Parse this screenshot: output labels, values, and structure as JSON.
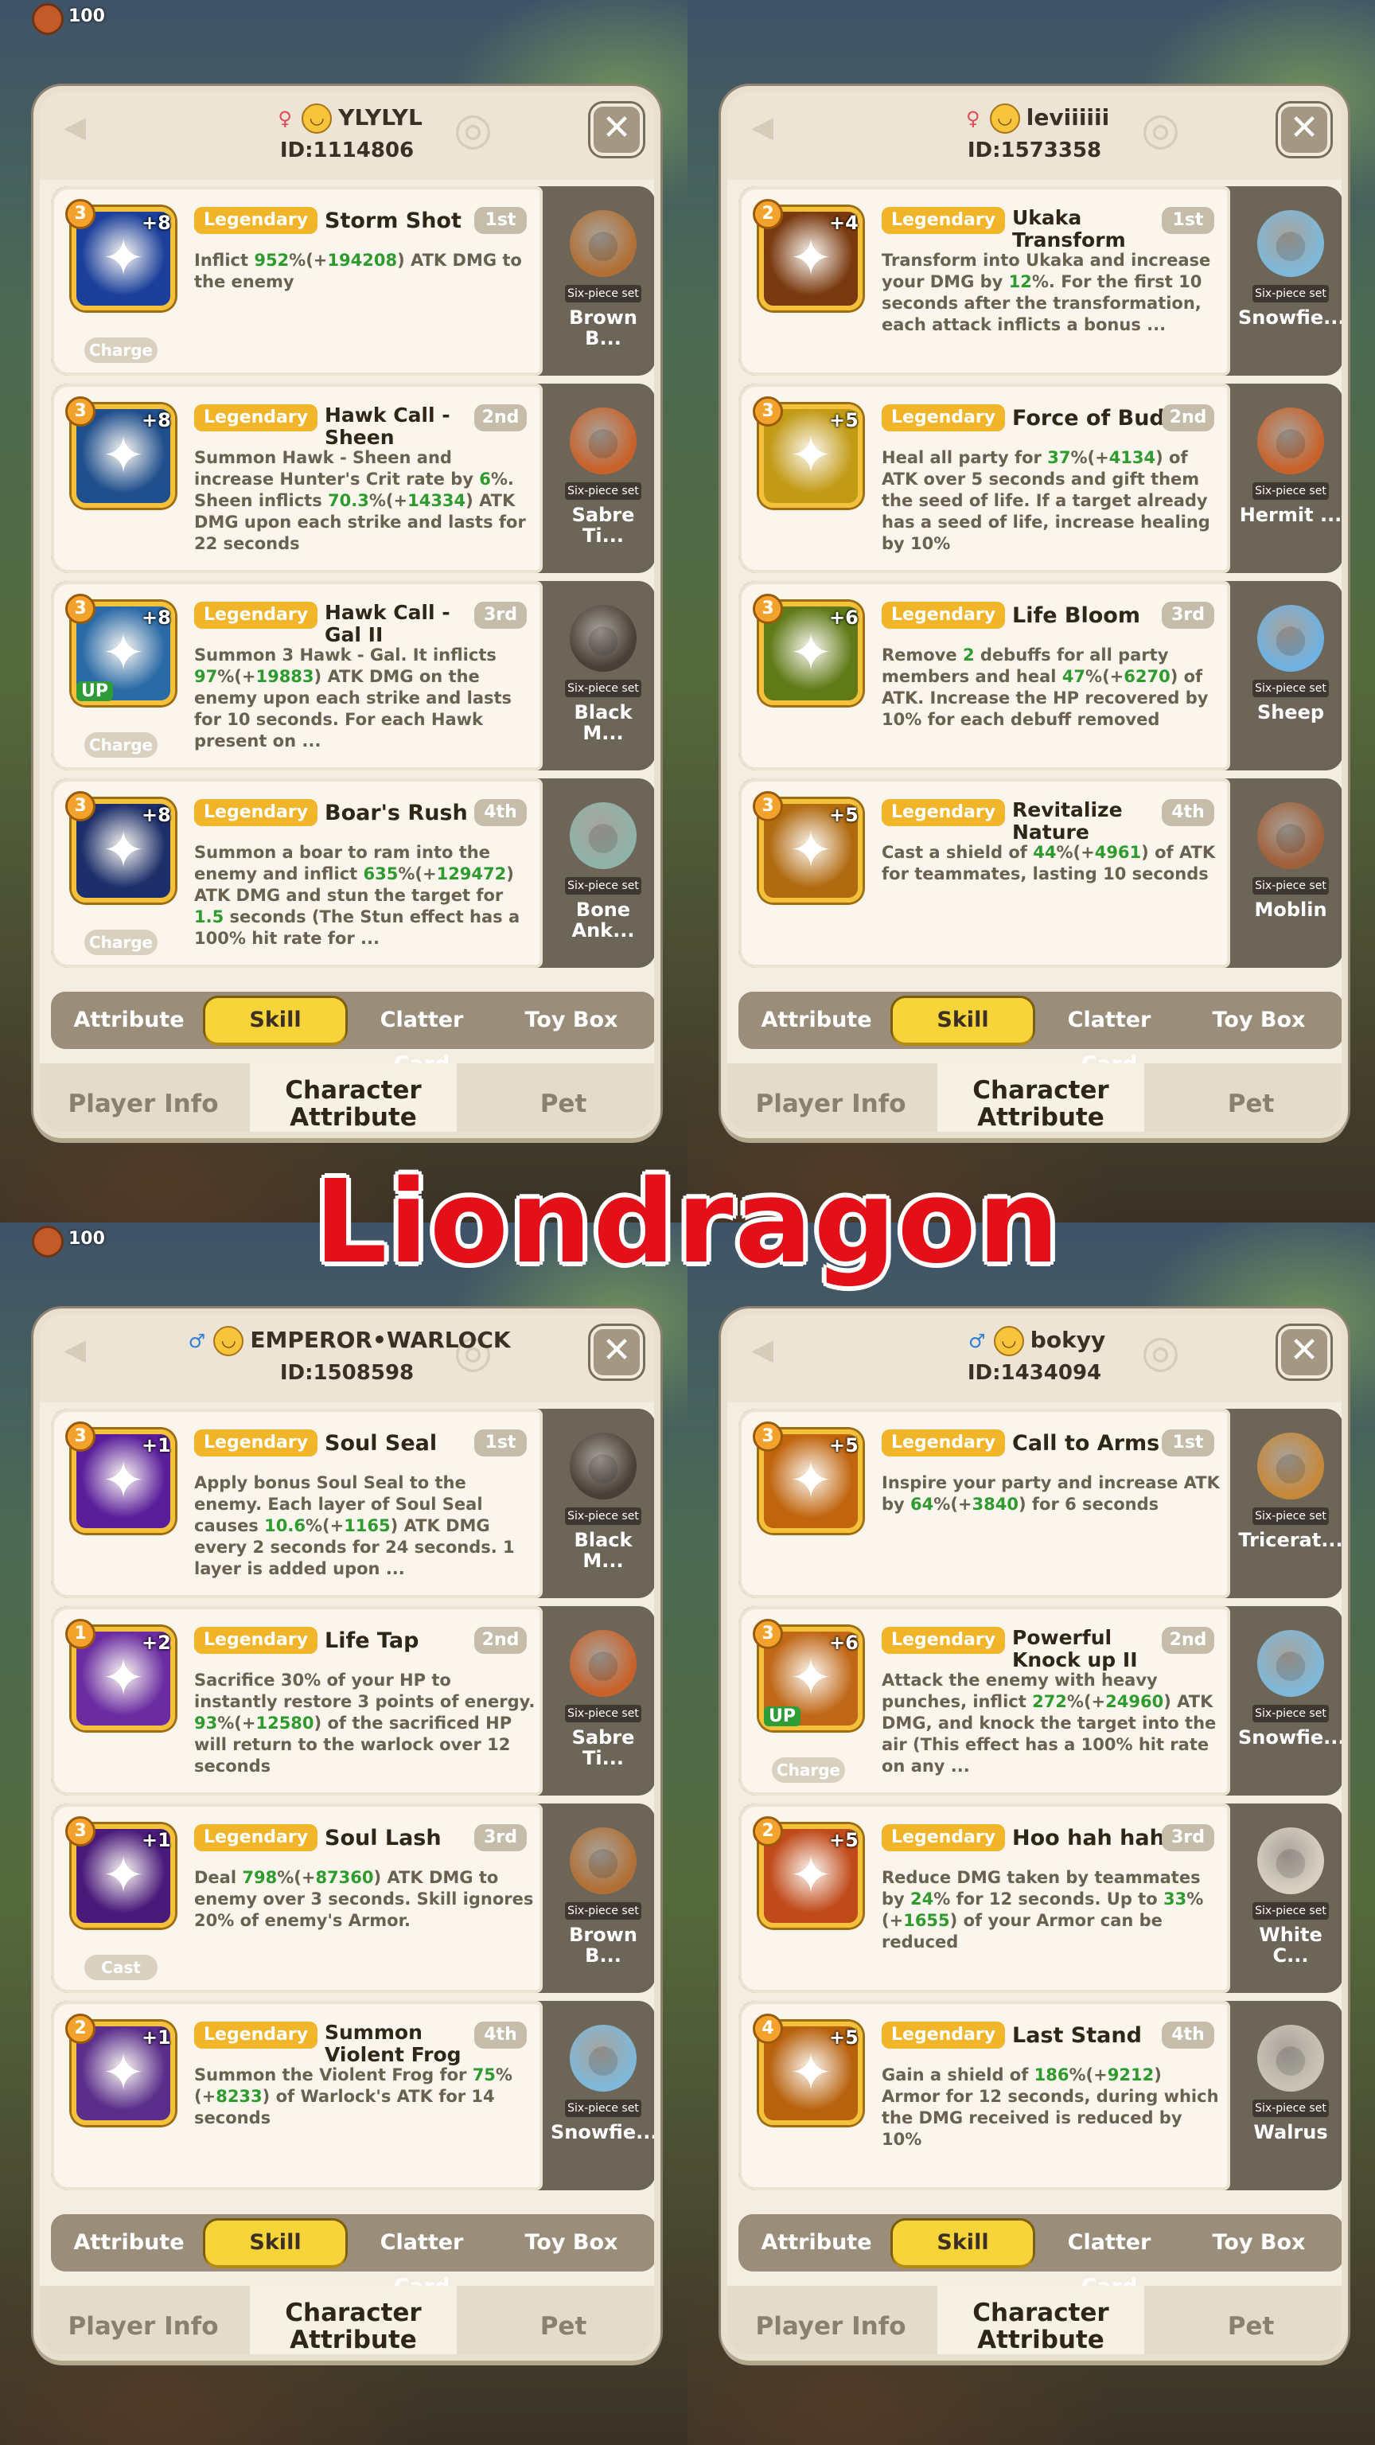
{
  "banner": {
    "text": "Liondragon"
  },
  "hud": {
    "number": "100"
  },
  "tabs": [
    "Attribute",
    "Skill",
    "Clatter Card",
    "Toy Box"
  ],
  "active_tab": "Skill",
  "nav": [
    "Player Info",
    "Character Attribute",
    "Pet"
  ],
  "active_nav": "Character Attribute",
  "set_label": "Six-piece set",
  "panels": [
    {
      "name": "YLYLYL",
      "id_text": "ID:1114806",
      "gender": "female",
      "skills": [
        {
          "level": "3",
          "plus": "+8",
          "rarity": "Legendary",
          "name": "Storm Shot",
          "ordinal": "1st",
          "type": "Charge",
          "up": false,
          "icon_color": "#1b3f9a",
          "icon": "icon-storm-shot",
          "desc": [
            [
              "Inflict ",
              ""
            ],
            [
              "952",
              "g"
            ],
            [
              "%(+",
              ""
            ],
            [
              "194208",
              "g"
            ],
            [
              ") ATK DMG to the enemy",
              ""
            ]
          ],
          "pet": "Brown B...",
          "pet_color": "#b07035",
          "pet_icon": "brown-bear-pet-icon"
        },
        {
          "level": "3",
          "plus": "+8",
          "rarity": "Legendary",
          "name": "Hawk Call - Sheen",
          "ordinal": "2nd",
          "type": "",
          "up": false,
          "icon_color": "#1f4f8c",
          "icon": "icon-hawk-call-sheen",
          "desc": [
            [
              "Summon Hawk - Sheen and increase Hunter's Crit rate by ",
              ""
            ],
            [
              "6",
              "g"
            ],
            [
              "%. Sheen inflicts ",
              ""
            ],
            [
              "70.3",
              "g"
            ],
            [
              "%(+",
              ""
            ],
            [
              "14334",
              "g"
            ],
            [
              ") ATK DMG upon each strike and lasts for 22 seconds",
              ""
            ]
          ],
          "pet": "Sabre Ti...",
          "pet_color": "#c8622a",
          "pet_icon": "sabre-tiger-pet-icon"
        },
        {
          "level": "3",
          "plus": "+8",
          "rarity": "Legendary",
          "name": "Hawk Call - Gal II",
          "ordinal": "3rd",
          "type": "Charge",
          "up": true,
          "icon_color": "#2a6aa6",
          "icon": "icon-hawk-call-gal",
          "desc": [
            [
              "Summon 3 Hawk - Gal. It inflicts ",
              ""
            ],
            [
              "97",
              "g"
            ],
            [
              "%(+",
              ""
            ],
            [
              "19883",
              "g"
            ],
            [
              ") ATK DMG on the enemy upon each strike and lasts for 10 seconds. For each Hawk present on ...",
              ""
            ]
          ],
          "pet": "Black M...",
          "pet_color": "#4a3e36",
          "pet_icon": "black-monkey-pet-icon"
        },
        {
          "level": "3",
          "plus": "+8",
          "rarity": "Legendary",
          "name": "Boar's Rush",
          "ordinal": "4th",
          "type": "Charge",
          "up": false,
          "icon_color": "#1d2f6a",
          "icon": "icon-boars-rush",
          "desc": [
            [
              "Summon a boar to ram into the enemy and inflict ",
              ""
            ],
            [
              "635",
              "g"
            ],
            [
              "%(+",
              ""
            ],
            [
              "129472",
              "g"
            ],
            [
              ") ATK DMG and stun the target for ",
              ""
            ],
            [
              "1.5",
              "g"
            ],
            [
              " seconds (The Stun effect has a 100% hit rate for ...",
              ""
            ]
          ],
          "pet": "Bone Ank...",
          "pet_color": "#8fb3a8",
          "pet_icon": "bone-ankylo-pet-icon"
        }
      ]
    },
    {
      "name": "leviiiiii",
      "id_text": "ID:1573358",
      "gender": "female",
      "skills": [
        {
          "level": "2",
          "plus": "+4",
          "rarity": "Legendary",
          "name": "Ukaka Transform",
          "ordinal": "1st",
          "type": "",
          "up": false,
          "icon_color": "#7a3a10",
          "icon": "icon-ukaka-transform",
          "desc": [
            [
              "Transform into Ukaka and increase your DMG by ",
              ""
            ],
            [
              "12",
              "g"
            ],
            [
              "%. For the first 10 seconds after the transformation, each attack inflicts a bonus ...",
              ""
            ]
          ],
          "pet": "Snowfie...",
          "pet_color": "#7fb8d8",
          "pet_icon": "snowfield-pet-icon"
        },
        {
          "level": "3",
          "plus": "+5",
          "rarity": "Legendary",
          "name": "Force of Bud",
          "ordinal": "2nd",
          "type": "",
          "up": false,
          "icon_color": "#c29a16",
          "icon": "icon-force-of-bud",
          "desc": [
            [
              "Heal all party for ",
              ""
            ],
            [
              "37",
              "g"
            ],
            [
              "%(+",
              ""
            ],
            [
              "4134",
              "g"
            ],
            [
              ") of ATK over 5 seconds and gift them the seed of life. If a target already has a seed of life, increase healing by 10%",
              ""
            ]
          ],
          "pet": "Hermit ...",
          "pet_color": "#c8622a",
          "pet_icon": "hermit-pet-icon"
        },
        {
          "level": "3",
          "plus": "+6",
          "rarity": "Legendary",
          "name": "Life Bloom",
          "ordinal": "3rd",
          "type": "",
          "up": false,
          "icon_color": "#5f7a16",
          "icon": "icon-life-bloom",
          "desc": [
            [
              "Remove ",
              ""
            ],
            [
              "2",
              "g"
            ],
            [
              " debuffs for all party members and heal ",
              ""
            ],
            [
              "47",
              "g"
            ],
            [
              "%(+",
              ""
            ],
            [
              "6270",
              "g"
            ],
            [
              ") of ATK. Increase the HP recovered by 10% for each debuff removed",
              ""
            ]
          ],
          "pet": "Sheep",
          "pet_color": "#6fb1e0",
          "pet_icon": "sheep-pet-icon"
        },
        {
          "level": "3",
          "plus": "+5",
          "rarity": "Legendary",
          "name": "Revitalize Nature",
          "ordinal": "4th",
          "type": "",
          "up": false,
          "icon_color": "#b06a10",
          "icon": "icon-revitalize-nature",
          "desc": [
            [
              "Cast a shield of ",
              ""
            ],
            [
              "44",
              "g"
            ],
            [
              "%(+",
              ""
            ],
            [
              "4961",
              "g"
            ],
            [
              ") of ATK for teammates, lasting 10 seconds",
              ""
            ]
          ],
          "pet": "Moblin",
          "pet_color": "#a0603a",
          "pet_icon": "moblin-pet-icon"
        }
      ]
    },
    {
      "name": "EMPEROR•WARLOCK",
      "id_text": "ID:1508598",
      "gender": "male",
      "skills": [
        {
          "level": "3",
          "plus": "+1",
          "rarity": "Legendary",
          "name": "Soul Seal",
          "ordinal": "1st",
          "type": "",
          "up": false,
          "icon_color": "#5a1e9a",
          "icon": "icon-soul-seal",
          "desc": [
            [
              "Apply bonus Soul Seal to the enemy. Each layer of Soul Seal causes ",
              ""
            ],
            [
              "10.6",
              "g"
            ],
            [
              "%(+",
              ""
            ],
            [
              "1165",
              "g"
            ],
            [
              ") ATK DMG every 2 seconds for 24 seconds. 1 layer is added upon ...",
              ""
            ]
          ],
          "pet": "Black M...",
          "pet_color": "#4a3e36",
          "pet_icon": "black-monkey-pet-icon"
        },
        {
          "level": "1",
          "plus": "+2",
          "rarity": "Legendary",
          "name": "Life Tap",
          "ordinal": "2nd",
          "type": "",
          "up": false,
          "icon_color": "#6a2ca0",
          "icon": "icon-life-tap",
          "desc": [
            [
              "Sacrifice 30% of your HP to instantly restore 3 points of energy. ",
              ""
            ],
            [
              "93",
              "g"
            ],
            [
              "%(+",
              ""
            ],
            [
              "12580",
              "g"
            ],
            [
              ") of the sacrificed HP will return to the warlock over 12 seconds",
              ""
            ]
          ],
          "pet": "Sabre Ti...",
          "pet_color": "#c8622a",
          "pet_icon": "sabre-tiger-pet-icon"
        },
        {
          "level": "3",
          "plus": "+1",
          "rarity": "Legendary",
          "name": "Soul Lash",
          "ordinal": "3rd",
          "type": "Cast",
          "up": false,
          "icon_color": "#4a1a7a",
          "icon": "icon-soul-lash",
          "desc": [
            [
              "Deal ",
              ""
            ],
            [
              "798",
              "g"
            ],
            [
              "%(+",
              ""
            ],
            [
              "87360",
              "g"
            ],
            [
              ") ATK DMG to enemy over 3 seconds. Skill ignores 20% of enemy's Armor.",
              ""
            ]
          ],
          "pet": "Brown B...",
          "pet_color": "#b07035",
          "pet_icon": "brown-bear-pet-icon"
        },
        {
          "level": "2",
          "plus": "+1",
          "rarity": "Legendary",
          "name": "Summon Violent Frog",
          "ordinal": "4th",
          "type": "",
          "up": false,
          "icon_color": "#5a2e8a",
          "icon": "icon-summon-violent-frog",
          "desc": [
            [
              "Summon the Violent Frog for ",
              ""
            ],
            [
              "75",
              "g"
            ],
            [
              "%(+",
              ""
            ],
            [
              "8233",
              "g"
            ],
            [
              ") of Warlock's ATK for 14 seconds",
              ""
            ]
          ],
          "pet": "Snowfie...",
          "pet_color": "#7fb8d8",
          "pet_icon": "snowfield-pet-icon"
        }
      ]
    },
    {
      "name": "bokyy",
      "id_text": "ID:1434094",
      "gender": "male",
      "skills": [
        {
          "level": "3",
          "plus": "+5",
          "rarity": "Legendary",
          "name": "Call to Arms",
          "ordinal": "1st",
          "type": "",
          "up": false,
          "icon_color": "#c0650e",
          "icon": "icon-call-to-arms",
          "desc": [
            [
              "Inspire your party and increase ATK by ",
              ""
            ],
            [
              "64",
              "g"
            ],
            [
              "%(+",
              ""
            ],
            [
              "3840",
              "g"
            ],
            [
              ") for 6 seconds",
              ""
            ]
          ],
          "pet": "Tricerat...",
          "pet_color": "#c6883a",
          "pet_icon": "triceratops-pet-icon"
        },
        {
          "level": "3",
          "plus": "+6",
          "rarity": "Legendary",
          "name": "Powerful Knock up II",
          "ordinal": "2nd",
          "type": "Charge",
          "up": true,
          "icon_color": "#c06818",
          "icon": "icon-powerful-knock-up",
          "desc": [
            [
              "Attack the enemy with heavy punches, inflict ",
              ""
            ],
            [
              "272",
              "g"
            ],
            [
              "%(+",
              ""
            ],
            [
              "24960",
              "g"
            ],
            [
              ") ATK DMG, and knock the target into the air (This effect has a 100% hit rate on any ...",
              ""
            ]
          ],
          "pet": "Snowfie...",
          "pet_color": "#7fb8d8",
          "pet_icon": "snowfield-pet-icon"
        },
        {
          "level": "2",
          "plus": "+5",
          "rarity": "Legendary",
          "name": "Hoo hah hah",
          "ordinal": "3rd",
          "type": "",
          "up": false,
          "icon_color": "#c04a1a",
          "icon": "icon-hoo-hah-hah",
          "desc": [
            [
              "Reduce DMG taken by teammates by ",
              ""
            ],
            [
              "24",
              "g"
            ],
            [
              "% for 12 seconds. Up to ",
              ""
            ],
            [
              "33",
              "g"
            ],
            [
              "%(+",
              ""
            ],
            [
              "1655",
              "g"
            ],
            [
              ") of your Armor can be reduced",
              ""
            ]
          ],
          "pet": "White C...",
          "pet_color": "#d8cfc0",
          "pet_icon": "white-cat-pet-icon"
        },
        {
          "level": "4",
          "plus": "+5",
          "rarity": "Legendary",
          "name": "Last Stand",
          "ordinal": "4th",
          "type": "",
          "up": false,
          "icon_color": "#b8620e",
          "icon": "icon-last-stand",
          "desc": [
            [
              "Gain a shield of ",
              ""
            ],
            [
              "186",
              "g"
            ],
            [
              "%(+",
              ""
            ],
            [
              "9212",
              "g"
            ],
            [
              ") Armor for 12 seconds, during which the DMG received is reduced by 10%",
              ""
            ]
          ],
          "pet": "Walrus",
          "pet_color": "#c8c4b4",
          "pet_icon": "walrus-pet-icon"
        }
      ]
    }
  ]
}
